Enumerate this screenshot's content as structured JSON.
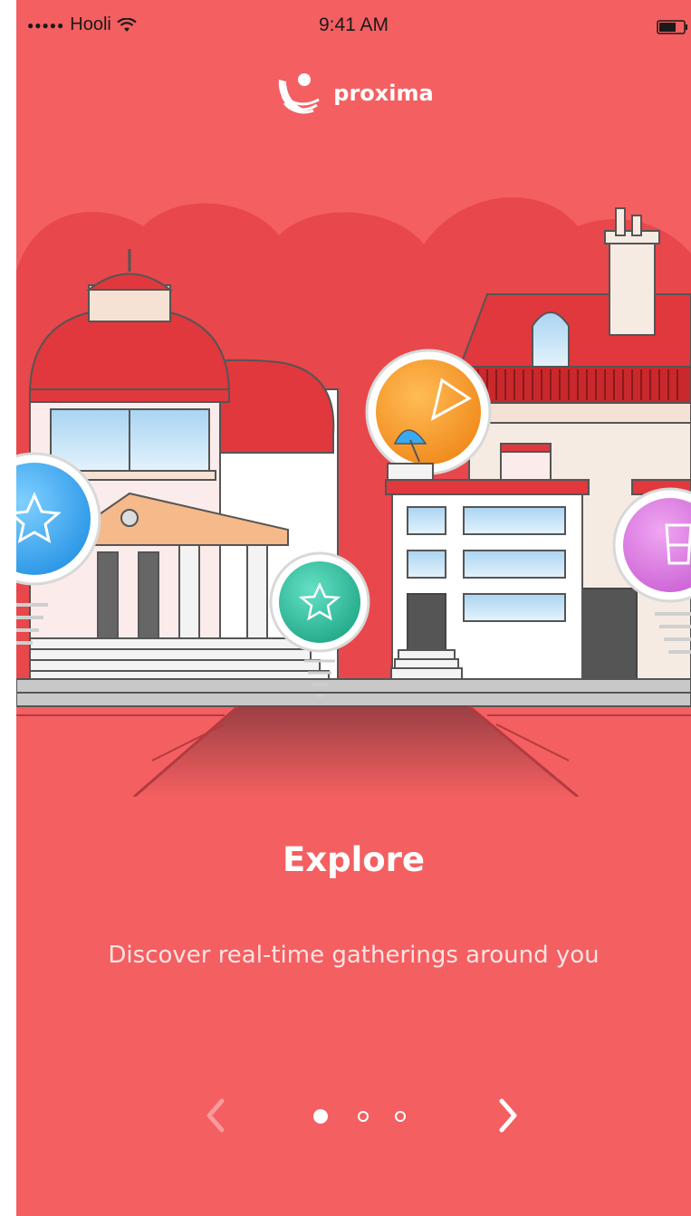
{
  "status_bar": {
    "signal": "●●●●●",
    "carrier": "Hooli",
    "time": "9:41 AM"
  },
  "brand": {
    "name": "proxima"
  },
  "onboarding": {
    "title": "Explore",
    "description": "Discover real-time gatherings around you",
    "current_page": 1,
    "total_pages": 3
  },
  "colors": {
    "background": "#f45f61",
    "accent_dark": "#e0383c",
    "pin_blue": "#3aa9ef",
    "pin_teal": "#34c3a4",
    "pin_orange": "#f59a2e",
    "pin_pink": "#d87adf"
  },
  "icons": {
    "logo": "proxima-logo-icon",
    "prev": "chevron-left-icon",
    "next": "chevron-right-icon",
    "wifi": "wifi-icon",
    "battery": "battery-icon"
  }
}
